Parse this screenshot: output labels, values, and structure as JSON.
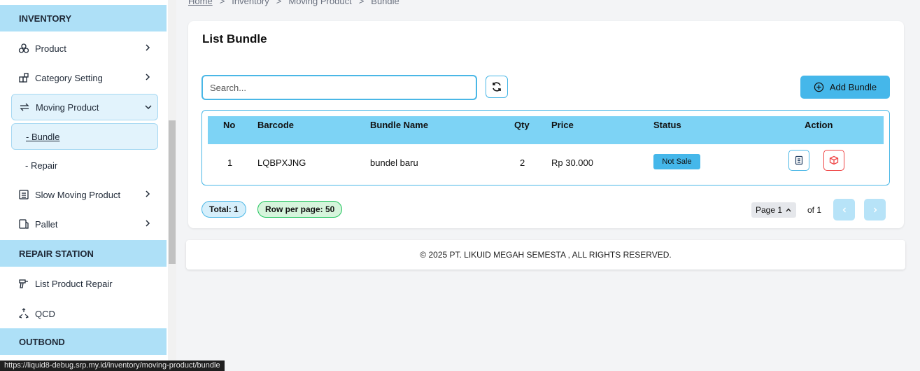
{
  "sidebar": {
    "section_inventory": "INVENTORY",
    "section_repair": "REPAIR STATION",
    "section_outbond": "OUTBOND",
    "items": [
      {
        "label": "Product",
        "icon": "cubes-icon"
      },
      {
        "label": "Category Setting",
        "icon": "category-icon"
      },
      {
        "label": "Moving Product",
        "icon": "arrows-exchange-icon"
      },
      {
        "label": "Slow Moving Product",
        "icon": "building-icon"
      },
      {
        "label": "Pallet",
        "icon": "pallet-icon"
      },
      {
        "label": "List Product Repair",
        "icon": "drill-icon"
      },
      {
        "label": "QCD",
        "icon": "recycle-icon"
      }
    ],
    "sub_items": [
      {
        "label": "- Bundle"
      },
      {
        "label": "- Repair"
      }
    ]
  },
  "breadcrumb": [
    "Home",
    ">",
    "Inventory",
    ">",
    "Moving Product",
    ">",
    "Bundle"
  ],
  "card": {
    "title": "List Bundle",
    "search_placeholder": "Search...",
    "add_label": "Add Bundle"
  },
  "table": {
    "headers": [
      "No",
      "Barcode",
      "Bundle Name",
      "Qty",
      "Price",
      "Status",
      "Action"
    ],
    "rows": [
      {
        "no": "1",
        "barcode": "LQBPXJNG",
        "name": "bundel baru",
        "qty": "2",
        "price": "Rp 30.000",
        "status": "Not Sale"
      }
    ]
  },
  "pagination": {
    "total": "Total: 1",
    "rows_per_page": "Row per page: 50",
    "page": "Page 1",
    "of": "of 1"
  },
  "footer": "© 2025 PT. LIKUID MEGAH SEMESTA , ALL RIGHTS RESERVED.",
  "status_url": "https://liquid8-debug.srp.my.id/inventory/moving-product/bundle",
  "colors": {
    "accent": "#45b7ea",
    "header": "#7dd3f5",
    "section": "#aee0f7",
    "danger": "#ef4444",
    "success": "#22c55e"
  }
}
